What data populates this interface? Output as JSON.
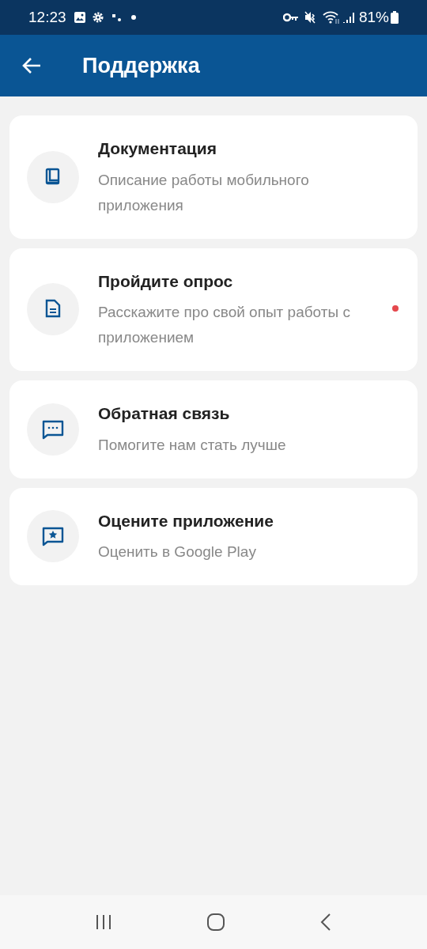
{
  "status_bar": {
    "time": "12:23",
    "battery": "81%"
  },
  "app_bar": {
    "title": "Поддержка"
  },
  "items": [
    {
      "kind": "book",
      "title": "Документация",
      "subtitle": "Описание работы мобильного приложения",
      "unread": false
    },
    {
      "kind": "document",
      "title": "Пройдите опрос",
      "subtitle": "Расскажите про свой опыт работы с приложением",
      "unread": true
    },
    {
      "kind": "chat",
      "title": "Обратная связь",
      "subtitle": "Помогите нам стать лучше",
      "unread": false
    },
    {
      "kind": "star",
      "title": "Оцените приложение",
      "subtitle": "Оценить в Google Play",
      "unread": false
    }
  ]
}
